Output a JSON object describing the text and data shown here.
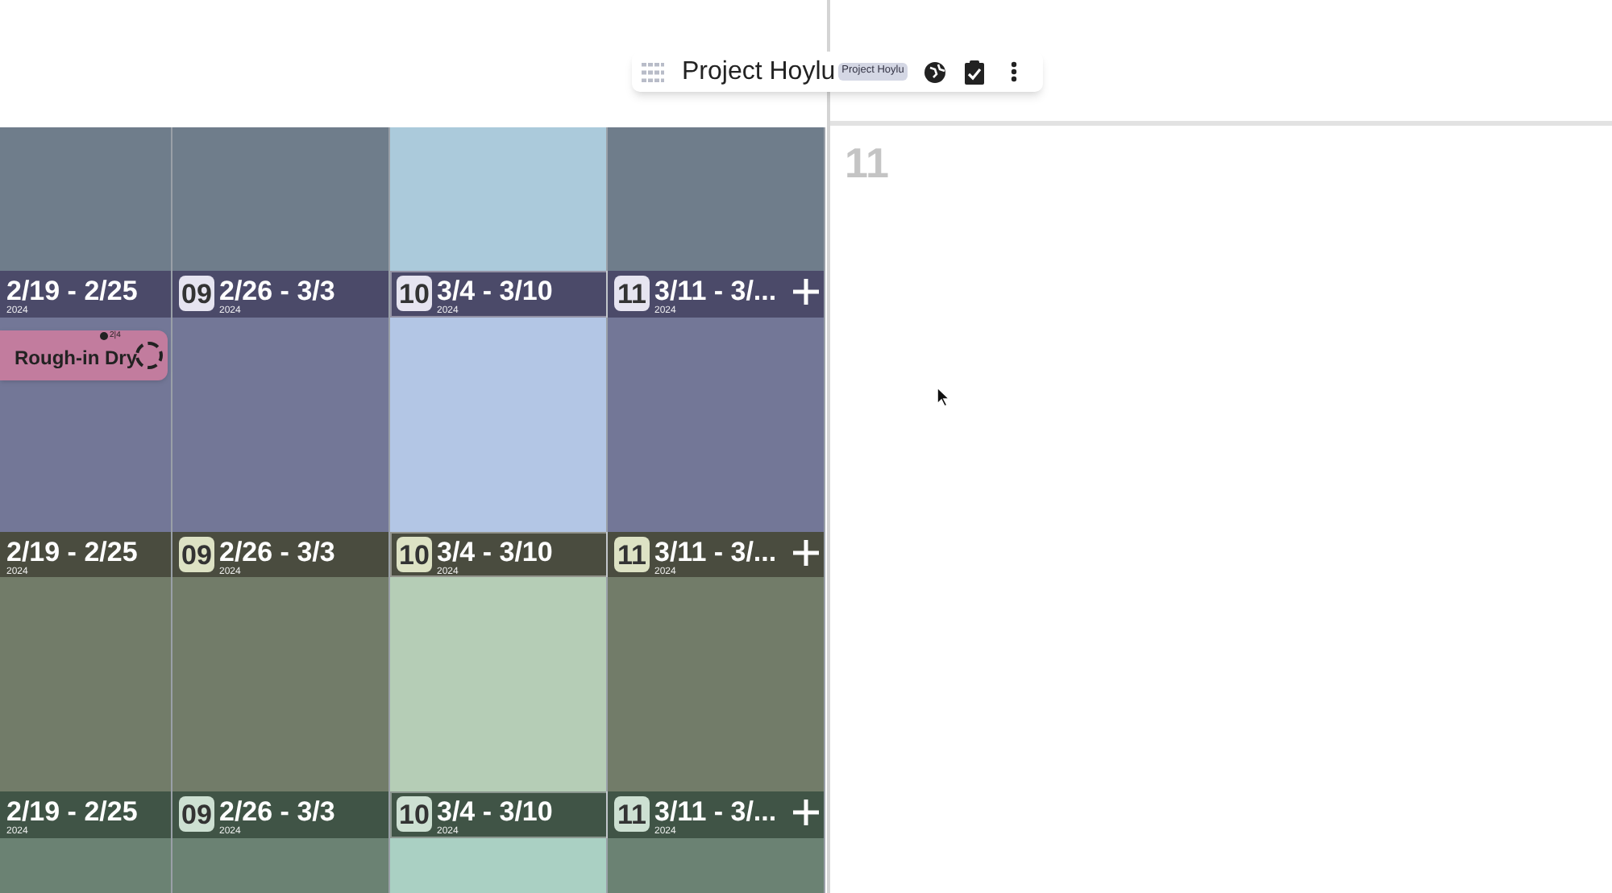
{
  "toolbar": {
    "title": "Project Hoylu",
    "tag": "Project Hoylu"
  },
  "column_label": "11",
  "columns": [
    {
      "current": false
    },
    {
      "current": false
    },
    {
      "current": true
    },
    {
      "current": false
    }
  ],
  "bands": [
    {
      "kind": "body"
    },
    {
      "kind": "header",
      "cells": [
        {
          "range": "2/19 - 2/25",
          "year": "2024"
        },
        {
          "number": "09",
          "range": "2/26 - 3/3",
          "year": "2024"
        },
        {
          "number": "10",
          "range": "3/4 - 3/10",
          "year": "2024"
        },
        {
          "number": "11",
          "range": "3/11 - 3/...",
          "year": "2024",
          "add": true
        }
      ]
    },
    {
      "kind": "body",
      "cells": [
        {
          "cards": [
            {
              "title": "Rough-in Dry",
              "count": "2|4"
            }
          ]
        },
        {},
        {},
        {}
      ]
    },
    {
      "kind": "header",
      "cells": [
        {
          "range": "2/19 - 2/25",
          "year": "2024"
        },
        {
          "number": "09",
          "range": "2/26 - 3/3",
          "year": "2024"
        },
        {
          "number": "10",
          "range": "3/4 - 3/10",
          "year": "2024"
        },
        {
          "number": "11",
          "range": "3/11 - 3/...",
          "year": "2024",
          "add": true
        }
      ]
    },
    {
      "kind": "body"
    },
    {
      "kind": "header",
      "cells": [
        {
          "range": "2/19 - 2/25",
          "year": "2024"
        },
        {
          "number": "09",
          "range": "2/26 - 3/3",
          "year": "2024"
        },
        {
          "number": "10",
          "range": "3/4 - 3/10",
          "year": "2024"
        },
        {
          "number": "11",
          "range": "3/11 - 3/...",
          "year": "2024",
          "add": true
        }
      ]
    },
    {
      "kind": "body"
    }
  ]
}
